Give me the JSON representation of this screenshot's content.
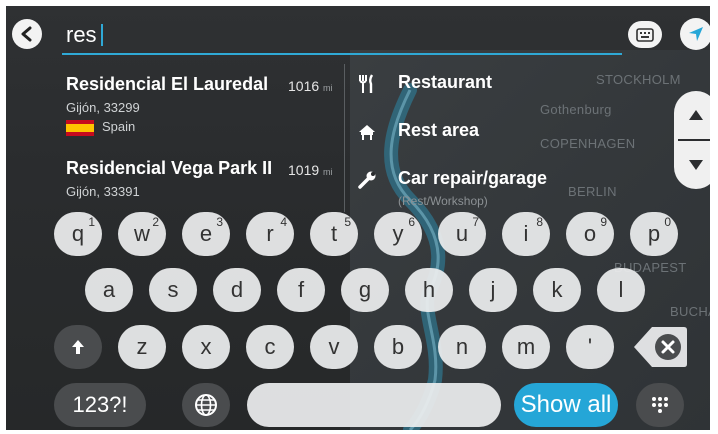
{
  "search": {
    "query": "res"
  },
  "results": [
    {
      "name": "Residencial El Lauredal",
      "distance": "1016",
      "unit": "mi",
      "address": "Gijón, 33299",
      "country": "Spain"
    },
    {
      "name": "Residencial Vega Park II",
      "distance": "1019",
      "unit": "mi",
      "address": "Gijón, 33391"
    }
  ],
  "categories": [
    {
      "label": "Restaurant",
      "icon": "fork-knife-icon"
    },
    {
      "label": "Rest area",
      "icon": "rest-area-icon"
    },
    {
      "label": "Car repair/garage",
      "icon": "wrench-icon",
      "sublabel": "(Rest/Workshop)"
    }
  ],
  "map": {
    "cities": [
      "STOCKHOLM",
      "Gothenburg",
      "COPENHAGEN",
      "BERLIN",
      "BUDAPEST",
      "BUCHA"
    ]
  },
  "keyboard": {
    "row1": [
      {
        "k": "q",
        "s": "1"
      },
      {
        "k": "w",
        "s": "2"
      },
      {
        "k": "e",
        "s": "3"
      },
      {
        "k": "r",
        "s": "4"
      },
      {
        "k": "t",
        "s": "5"
      },
      {
        "k": "y",
        "s": "6"
      },
      {
        "k": "u",
        "s": "7"
      },
      {
        "k": "i",
        "s": "8"
      },
      {
        "k": "o",
        "s": "9"
      },
      {
        "k": "p",
        "s": "0"
      }
    ],
    "row2": [
      "a",
      "s",
      "d",
      "f",
      "g",
      "h",
      "j",
      "k",
      "l"
    ],
    "row3": [
      "z",
      "x",
      "c",
      "v",
      "b",
      "n",
      "m",
      "'"
    ],
    "numsym_label": "123?!",
    "show_all_label": "Show all"
  },
  "colors": {
    "accent": "#25a6d7",
    "background": "#2b2d2f",
    "key": "#ecedee"
  }
}
